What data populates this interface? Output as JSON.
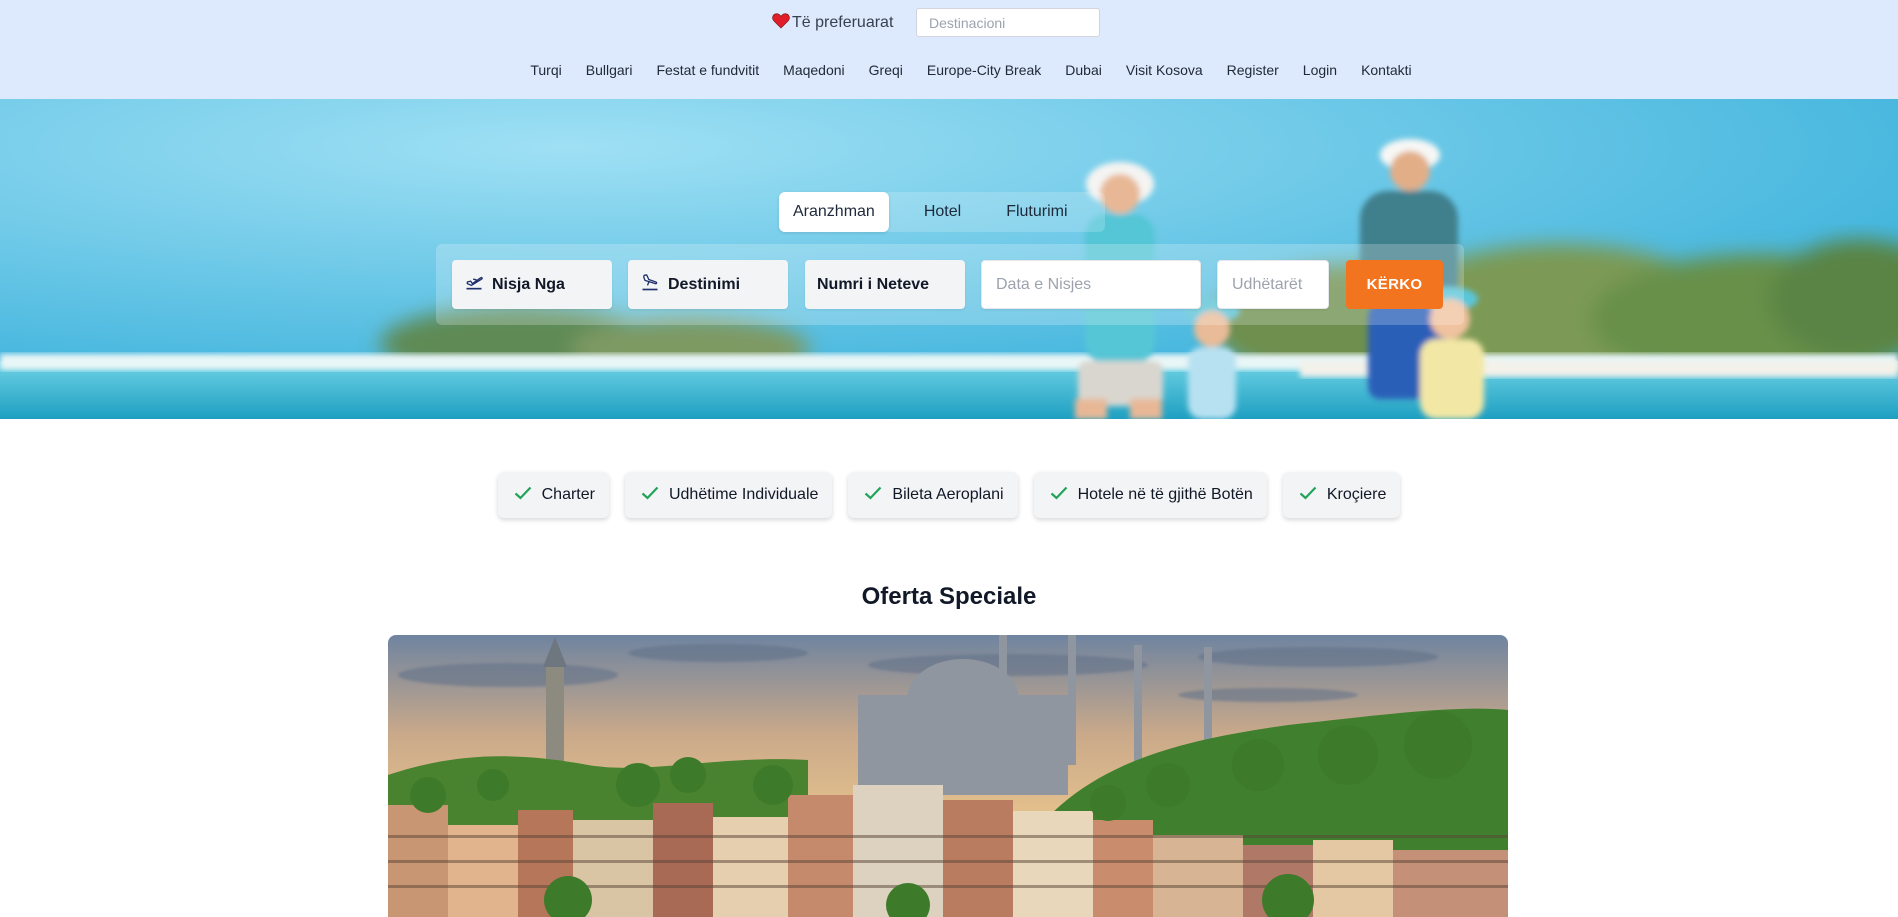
{
  "header": {
    "favorites_label": "Të preferuarat",
    "destination_placeholder": "Destinacioni",
    "nav": [
      "Turqi",
      "Bullgari",
      "Festat e fundvitit",
      "Maqedoni",
      "Greqi",
      "Europe-City Break",
      "Dubai",
      "Visit Kosova",
      "Register",
      "Login",
      "Kontakti"
    ]
  },
  "search": {
    "tabs": [
      "Aranzhman",
      "Hotel",
      "Fluturimi"
    ],
    "active_tab": "Aranzhman",
    "departure_label": "Nisja Nga",
    "destination_label": "Destinimi",
    "nights_label": "Numri i Neteve",
    "date_placeholder": "Data e Nisjes",
    "travelers_placeholder": "Udhëtarët",
    "submit_label": "KËRKO"
  },
  "features": [
    "Charter",
    "Udhëtime Individuale",
    "Bileta Aeroplani",
    "Hotele në të gjithë Botën",
    "Kroçiere"
  ],
  "offers": {
    "title": "Oferta Speciale"
  },
  "colors": {
    "header_bg": "#dde9fc",
    "accent": "#f2741f",
    "check": "#22a35a"
  },
  "icons": {
    "favorites": "heart-icon",
    "departure": "plane-departure-icon",
    "destination": "plane-arrival-icon",
    "feature": "check-icon"
  }
}
